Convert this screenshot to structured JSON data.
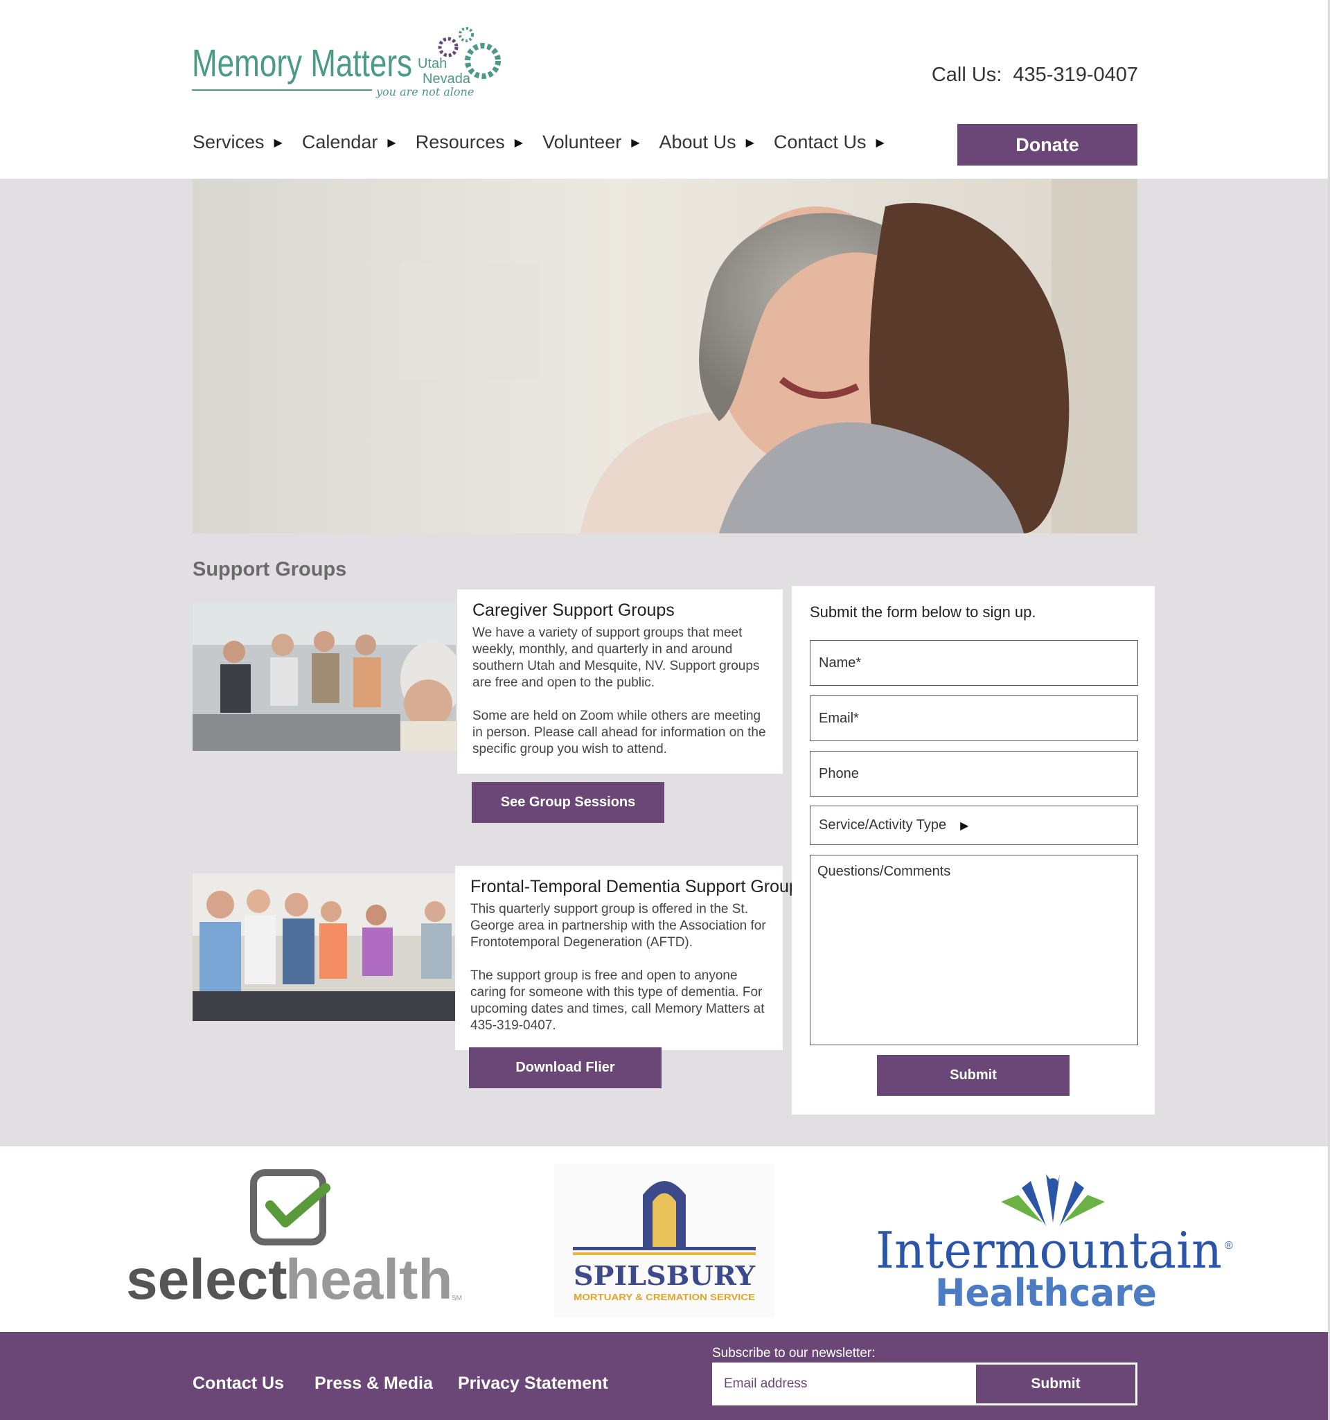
{
  "header": {
    "logo": {
      "wordmark": "Memory Matters",
      "region_line1": "Utah",
      "region_line2": "Nevada",
      "tagline": "you are not alone",
      "icon": "gears-icon"
    },
    "call_label": "Call Us:",
    "phone": "435-319-0407",
    "nav": [
      {
        "label": "Services",
        "icon": "triangle-right-icon"
      },
      {
        "label": "Calendar",
        "icon": "triangle-right-icon"
      },
      {
        "label": "Resources",
        "icon": "triangle-right-icon"
      },
      {
        "label": "Volunteer",
        "icon": "triangle-right-icon"
      },
      {
        "label": "About Us",
        "icon": "triangle-right-icon"
      },
      {
        "label": "Contact Us",
        "icon": "triangle-right-icon"
      }
    ],
    "donate_label": "Donate"
  },
  "main": {
    "section_title": "Support Groups",
    "groups": [
      {
        "title": "Caregiver Support Groups",
        "paragraphs": [
          "We have a variety of support groups that meet weekly, monthly, and quarterly in and around southern Utah and Mesquite, NV. Support groups are free and open to the public.",
          "Some are held on Zoom while others are meeting in person. Please call ahead for information on the specific group you wish to attend."
        ],
        "button": "See Group Sessions"
      },
      {
        "title": "Frontal-Temporal Dementia Support Group",
        "paragraphs": [
          "This quarterly support group is offered in the St. George area in partnership with the Association for Frontotemporal Degeneration (AFTD).",
          "The support group is free and open to anyone caring for someone with this type of dementia. For upcoming dates and times, call Memory Matters at 435-319-0407."
        ],
        "button": "Download Flier"
      }
    ],
    "form": {
      "heading": "Submit the form below to sign up.",
      "name": "Name*",
      "email": "Email*",
      "phone": "Phone",
      "service": "Service/Activity Type",
      "comments": "Questions/Comments",
      "submit": "Submit"
    }
  },
  "partners": {
    "selecthealth": {
      "word1": "select",
      "word2": "health",
      "mark": "SM"
    },
    "spilsbury": {
      "name": "SPILSBURY",
      "sub": "MORTUARY & CREMATION SERVICE"
    },
    "intermountain": {
      "line1": "Intermountain",
      "line2": "Healthcare",
      "mark": "®"
    }
  },
  "footer": {
    "links": [
      "Contact Us",
      "Press & Media",
      "Privacy Statement"
    ],
    "subscribe_label": "Subscribe to our newsletter:",
    "email_placeholder": "Email address",
    "submit": "Submit"
  },
  "colors": {
    "brand_purple": "#6a4776",
    "brand_green": "#4a9a86",
    "page_gray": "#e1dfe1"
  }
}
